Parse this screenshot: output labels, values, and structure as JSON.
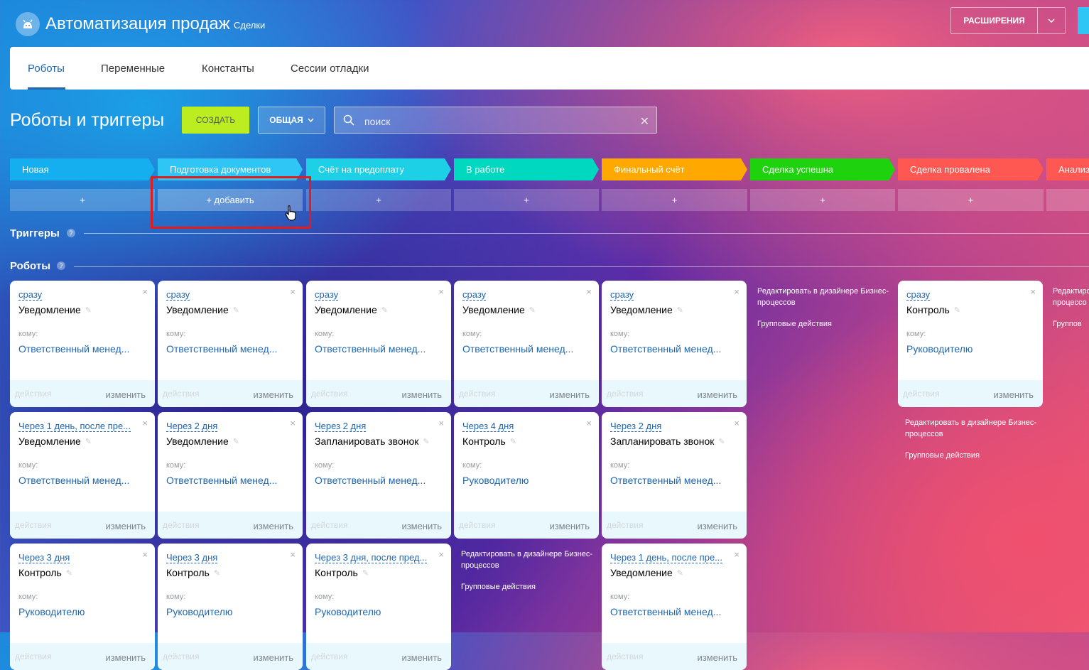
{
  "header": {
    "app_title": "Автоматизация продаж",
    "app_subtitle": "Сделки",
    "extensions_label": "РАСШИРЕНИЯ"
  },
  "tabs": [
    {
      "label": "Роботы",
      "active": true
    },
    {
      "label": "Переменные"
    },
    {
      "label": "Константы"
    },
    {
      "label": "Сессии отладки"
    }
  ],
  "toolbar": {
    "title": "Роботы и триггеры",
    "create_label": "СОЗДАТЬ",
    "general_label": "ОБЩАЯ",
    "search_placeholder": "поиск"
  },
  "stages": [
    {
      "label": "Новая",
      "color": "#15aeef"
    },
    {
      "label": "Подготовка документов",
      "color": "#2fc6f6"
    },
    {
      "label": "Счёт на предоплату",
      "color": "#1ed0e6"
    },
    {
      "label": "В работе",
      "color": "#00d9c0"
    },
    {
      "label": "Финальный счёт",
      "color": "#ffa900"
    },
    {
      "label": "Сделка успешна",
      "color": "#1fd20e"
    },
    {
      "label": "Сделка провалена",
      "color": "#ff5752"
    },
    {
      "label": "Анализ",
      "color": "#ff5752"
    }
  ],
  "add_row": {
    "plus": "+",
    "add_label": "+ добавить"
  },
  "sections": {
    "triggers": "Триггеры",
    "robots": "Роботы",
    "help_mark": "?"
  },
  "card_common": {
    "to_label": "кому:",
    "actions_label": "действия",
    "edit_label": "изменить",
    "close_glyph": "×",
    "edit_glyph": "✎"
  },
  "column_links": {
    "designer": "Редактировать в дизайнере Бизнес-процессов",
    "group": "Групповые действия"
  },
  "robots": [
    {
      "when": "сразу",
      "title": "Уведомление",
      "who": "Ответственный менед..."
    },
    {
      "when": "сразу",
      "title": "Уведомление",
      "who": "Ответственный менед..."
    },
    {
      "when": "сразу",
      "title": "Уведомление",
      "who": "Ответственный менед..."
    },
    {
      "when": "сразу",
      "title": "Уведомление",
      "who": "Ответственный менед..."
    },
    {
      "when": "сразу",
      "title": "Уведомление",
      "who": "Ответственный менед..."
    },
    {
      "when": "сразу",
      "title": "Контроль",
      "who": "Руководителю"
    },
    {
      "when": "Через 1 день, после пре...",
      "title": "Уведомление",
      "who": "Ответственный менед..."
    },
    {
      "when": "Через 2 дня",
      "title": "Уведомление",
      "who": "Ответственный менед..."
    },
    {
      "when": "Через 2 дня",
      "title": "Запланировать звонок",
      "who": "Ответственный менед..."
    },
    {
      "when": "Через 4 дня",
      "title": "Контроль",
      "who": "Руководителю"
    },
    {
      "when": "Через 2 дня",
      "title": "Запланировать звонок",
      "who": "Ответственный менед..."
    },
    {
      "when": "Через 3 дня",
      "title": "Контроль",
      "who": "Руководителю"
    },
    {
      "when": "Через 3 дня",
      "title": "Контроль",
      "who": "Руководителю"
    },
    {
      "when": "Через 3 дня, после пред...",
      "title": "Контроль",
      "who": "Руководителю"
    },
    {
      "when": "Через 1 день, после пре...",
      "title": "Уведомление",
      "who": "Ответственный менед..."
    }
  ]
}
